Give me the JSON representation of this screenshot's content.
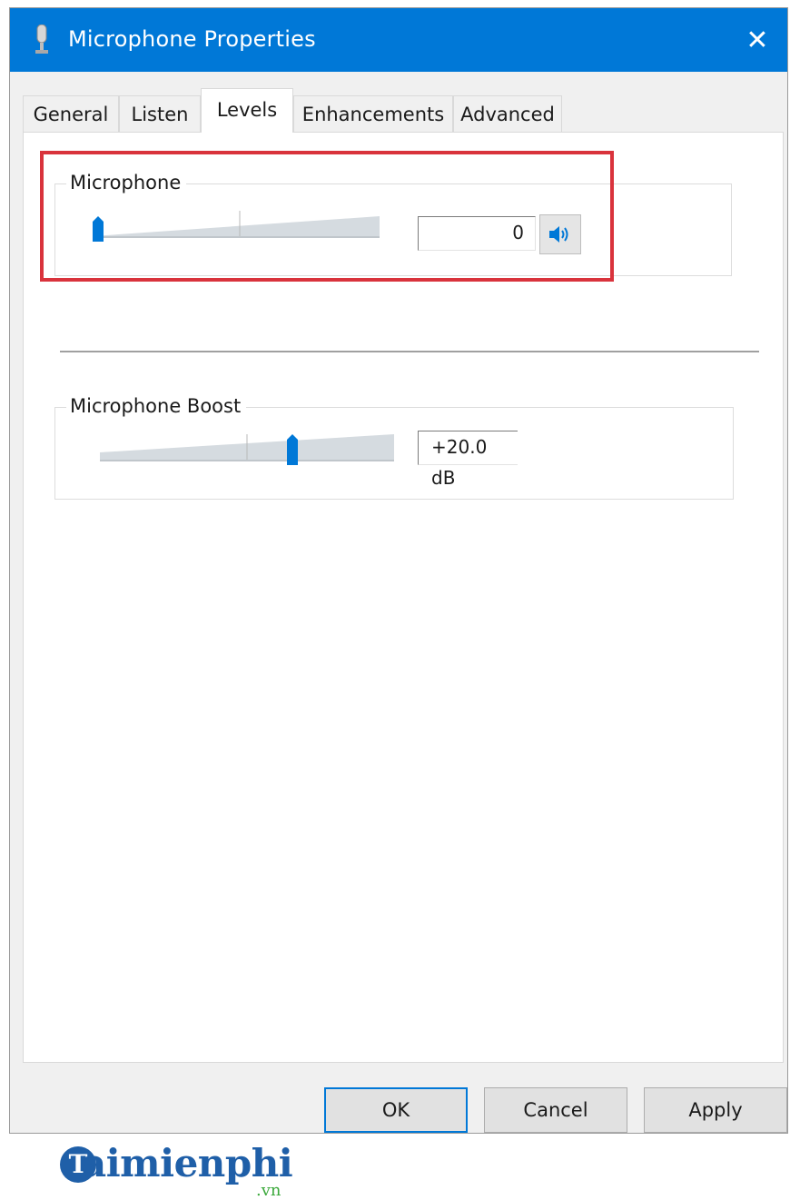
{
  "window": {
    "title": "Microphone Properties",
    "close_glyph": "✕",
    "icon": "microphone-icon"
  },
  "tabs": [
    {
      "label": "General",
      "active": false
    },
    {
      "label": "Listen",
      "active": false
    },
    {
      "label": "Levels",
      "active": true
    },
    {
      "label": "Enhancements",
      "active": false
    },
    {
      "label": "Advanced",
      "active": false
    }
  ],
  "levels": {
    "microphone": {
      "label": "Microphone",
      "value": "0",
      "level_percent": 0,
      "mute_icon": "speaker-icon"
    },
    "boost": {
      "label": "Microphone Boost",
      "value": "+20.0 dB",
      "level_fraction": 0.667
    }
  },
  "buttons": {
    "ok": "OK",
    "cancel": "Cancel",
    "apply": "Apply"
  },
  "watermark": {
    "text": "aimienphi",
    "suffix": ".vn"
  },
  "colors": {
    "accent": "#0078d7",
    "highlight": "#d9333c"
  }
}
